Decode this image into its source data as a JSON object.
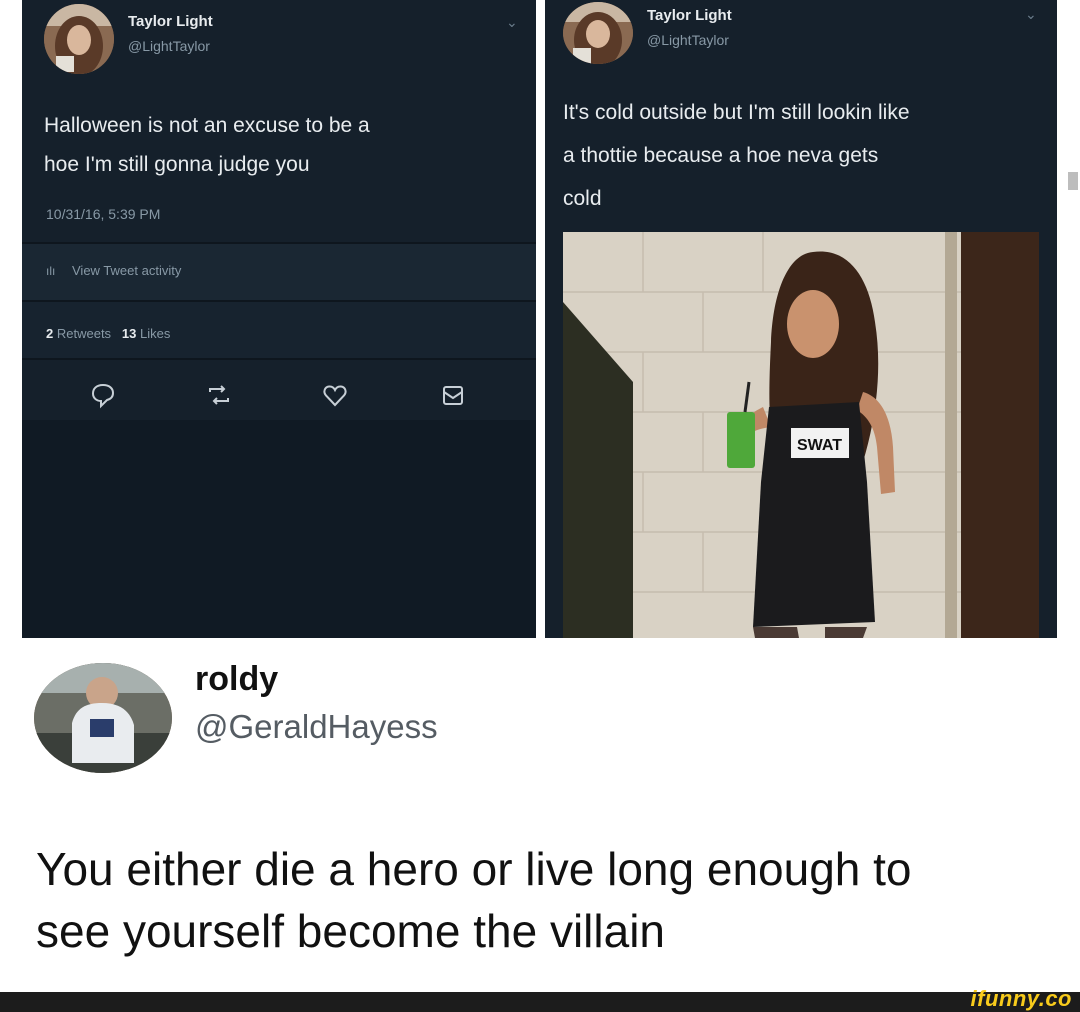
{
  "tweet_left": {
    "name": "Taylor Light",
    "handle": "@LightTaylor",
    "text_line1": "Halloween is not an excuse to be a",
    "text_line2": "hoe I'm still gonna judge you",
    "timestamp": "10/31/16, 5:39 PM",
    "activity_label": "View Tweet activity",
    "retweets_count": "2",
    "retweets_label": "Retweets",
    "likes_count": "13",
    "likes_label": "Likes"
  },
  "tweet_right": {
    "name": "Taylor Light",
    "handle": "@LightTaylor",
    "text_line1": "It's cold outside but I'm still lookin like",
    "text_line2": "a thottie because a hoe neva gets",
    "text_line3": "cold",
    "cup_text": "SWAT"
  },
  "quote": {
    "name": "roldy",
    "handle": "@GeraldHayess",
    "text_line1": "You either die a hero or live long enough to",
    "text_line2": "see yourself become the villain"
  },
  "watermark": "ifunny.co",
  "colors": {
    "tweet_bg": "#15202b",
    "text_light": "#e8ecef",
    "text_muted": "#8899a6",
    "watermark": "#f8cb1c"
  },
  "icons": {
    "reply": "speech-bubble-icon",
    "retweet": "retweet-icon",
    "like": "heart-icon",
    "dm": "envelope-icon",
    "chevron": "chevron-down-icon",
    "activity": "bar-chart-icon"
  }
}
